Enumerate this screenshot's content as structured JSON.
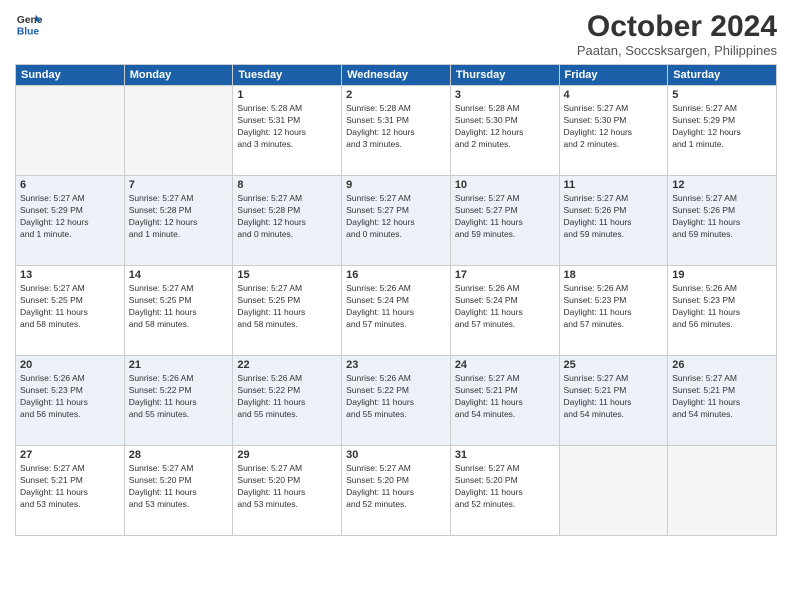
{
  "logo": {
    "line1": "General",
    "line2": "Blue"
  },
  "title": "October 2024",
  "subtitle": "Paatan, Soccsksargen, Philippines",
  "days_header": [
    "Sunday",
    "Monday",
    "Tuesday",
    "Wednesday",
    "Thursday",
    "Friday",
    "Saturday"
  ],
  "weeks": [
    [
      {
        "day": "",
        "info": ""
      },
      {
        "day": "",
        "info": ""
      },
      {
        "day": "1",
        "info": "Sunrise: 5:28 AM\nSunset: 5:31 PM\nDaylight: 12 hours\nand 3 minutes."
      },
      {
        "day": "2",
        "info": "Sunrise: 5:28 AM\nSunset: 5:31 PM\nDaylight: 12 hours\nand 3 minutes."
      },
      {
        "day": "3",
        "info": "Sunrise: 5:28 AM\nSunset: 5:30 PM\nDaylight: 12 hours\nand 2 minutes."
      },
      {
        "day": "4",
        "info": "Sunrise: 5:27 AM\nSunset: 5:30 PM\nDaylight: 12 hours\nand 2 minutes."
      },
      {
        "day": "5",
        "info": "Sunrise: 5:27 AM\nSunset: 5:29 PM\nDaylight: 12 hours\nand 1 minute."
      }
    ],
    [
      {
        "day": "6",
        "info": "Sunrise: 5:27 AM\nSunset: 5:29 PM\nDaylight: 12 hours\nand 1 minute."
      },
      {
        "day": "7",
        "info": "Sunrise: 5:27 AM\nSunset: 5:28 PM\nDaylight: 12 hours\nand 1 minute."
      },
      {
        "day": "8",
        "info": "Sunrise: 5:27 AM\nSunset: 5:28 PM\nDaylight: 12 hours\nand 0 minutes."
      },
      {
        "day": "9",
        "info": "Sunrise: 5:27 AM\nSunset: 5:27 PM\nDaylight: 12 hours\nand 0 minutes."
      },
      {
        "day": "10",
        "info": "Sunrise: 5:27 AM\nSunset: 5:27 PM\nDaylight: 11 hours\nand 59 minutes."
      },
      {
        "day": "11",
        "info": "Sunrise: 5:27 AM\nSunset: 5:26 PM\nDaylight: 11 hours\nand 59 minutes."
      },
      {
        "day": "12",
        "info": "Sunrise: 5:27 AM\nSunset: 5:26 PM\nDaylight: 11 hours\nand 59 minutes."
      }
    ],
    [
      {
        "day": "13",
        "info": "Sunrise: 5:27 AM\nSunset: 5:25 PM\nDaylight: 11 hours\nand 58 minutes."
      },
      {
        "day": "14",
        "info": "Sunrise: 5:27 AM\nSunset: 5:25 PM\nDaylight: 11 hours\nand 58 minutes."
      },
      {
        "day": "15",
        "info": "Sunrise: 5:27 AM\nSunset: 5:25 PM\nDaylight: 11 hours\nand 58 minutes."
      },
      {
        "day": "16",
        "info": "Sunrise: 5:26 AM\nSunset: 5:24 PM\nDaylight: 11 hours\nand 57 minutes."
      },
      {
        "day": "17",
        "info": "Sunrise: 5:26 AM\nSunset: 5:24 PM\nDaylight: 11 hours\nand 57 minutes."
      },
      {
        "day": "18",
        "info": "Sunrise: 5:26 AM\nSunset: 5:23 PM\nDaylight: 11 hours\nand 57 minutes."
      },
      {
        "day": "19",
        "info": "Sunrise: 5:26 AM\nSunset: 5:23 PM\nDaylight: 11 hours\nand 56 minutes."
      }
    ],
    [
      {
        "day": "20",
        "info": "Sunrise: 5:26 AM\nSunset: 5:23 PM\nDaylight: 11 hours\nand 56 minutes."
      },
      {
        "day": "21",
        "info": "Sunrise: 5:26 AM\nSunset: 5:22 PM\nDaylight: 11 hours\nand 55 minutes."
      },
      {
        "day": "22",
        "info": "Sunrise: 5:26 AM\nSunset: 5:22 PM\nDaylight: 11 hours\nand 55 minutes."
      },
      {
        "day": "23",
        "info": "Sunrise: 5:26 AM\nSunset: 5:22 PM\nDaylight: 11 hours\nand 55 minutes."
      },
      {
        "day": "24",
        "info": "Sunrise: 5:27 AM\nSunset: 5:21 PM\nDaylight: 11 hours\nand 54 minutes."
      },
      {
        "day": "25",
        "info": "Sunrise: 5:27 AM\nSunset: 5:21 PM\nDaylight: 11 hours\nand 54 minutes."
      },
      {
        "day": "26",
        "info": "Sunrise: 5:27 AM\nSunset: 5:21 PM\nDaylight: 11 hours\nand 54 minutes."
      }
    ],
    [
      {
        "day": "27",
        "info": "Sunrise: 5:27 AM\nSunset: 5:21 PM\nDaylight: 11 hours\nand 53 minutes."
      },
      {
        "day": "28",
        "info": "Sunrise: 5:27 AM\nSunset: 5:20 PM\nDaylight: 11 hours\nand 53 minutes."
      },
      {
        "day": "29",
        "info": "Sunrise: 5:27 AM\nSunset: 5:20 PM\nDaylight: 11 hours\nand 53 minutes."
      },
      {
        "day": "30",
        "info": "Sunrise: 5:27 AM\nSunset: 5:20 PM\nDaylight: 11 hours\nand 52 minutes."
      },
      {
        "day": "31",
        "info": "Sunrise: 5:27 AM\nSunset: 5:20 PM\nDaylight: 11 hours\nand 52 minutes."
      },
      {
        "day": "",
        "info": ""
      },
      {
        "day": "",
        "info": ""
      }
    ]
  ]
}
